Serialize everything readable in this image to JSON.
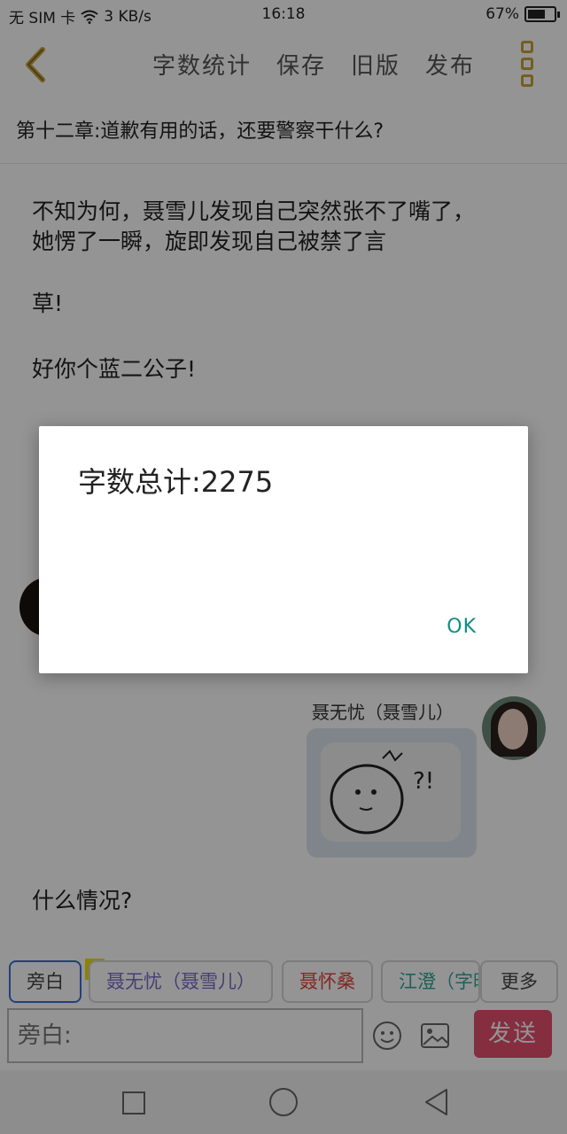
{
  "status_bar": {
    "carrier": "无 SIM 卡",
    "network_speed": "3 KB/s",
    "time": "16:18",
    "battery_text": "67%",
    "battery_level_percent": 67
  },
  "toolbar": {
    "word_count_label": "字数统计",
    "save_label": "保存",
    "old_version_label": "旧版",
    "publish_label": "发布"
  },
  "chapter_title": "第十二章:道歉有用的话，还要警察干什么?",
  "content": {
    "para1_line1": "不知为何，聂雪儿发现自己突然张不了嘴了，",
    "para1_line2": "她愣了一瞬，旋即发现自己被禁了言",
    "para2": "草!",
    "para3": "好你个蓝二公子!",
    "last_para": "什么情况?",
    "speaker_name": "聂无忧（聂雪儿）"
  },
  "chips": {
    "narration": "旁白",
    "main_tag": "主",
    "char1": "聂无忧（聂雪儿）",
    "char2": "聂怀桑",
    "char3": "江澄（字晚",
    "more": "更多"
  },
  "input": {
    "placeholder": "旁白:",
    "send_label": "发送"
  },
  "dialog": {
    "message": "字数总计:2275",
    "ok_label": "OK"
  },
  "colors": {
    "accent_gold": "#c8a23a",
    "send_pink": "#e4506e",
    "ok_teal": "#0f8f84",
    "char1_color": "#7b6bc9",
    "char2_color": "#e0453c",
    "char3_color": "#2fa79a"
  },
  "icons": {
    "back": "chevron-left-icon",
    "more": "more-vertical-icon",
    "emoji": "emoji-icon",
    "image": "image-icon"
  }
}
